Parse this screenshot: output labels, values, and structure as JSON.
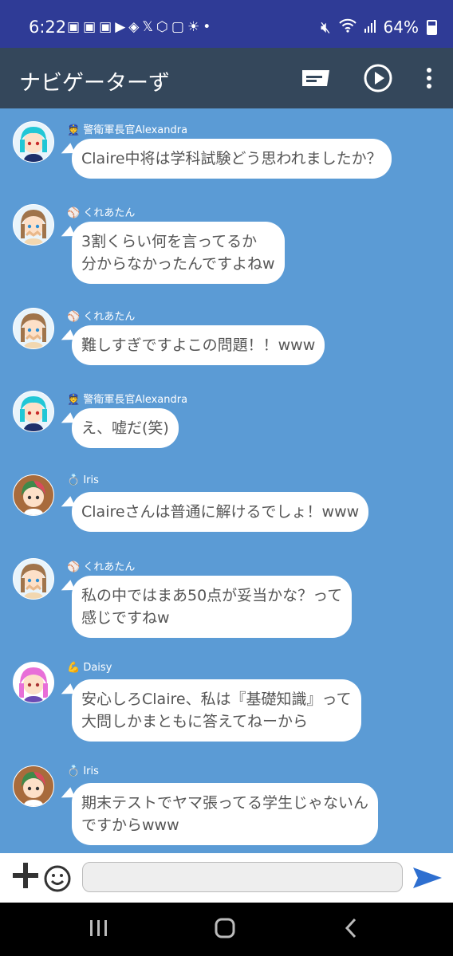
{
  "status_bar": {
    "time": "6:22",
    "notification_icons": [
      "discord-icon",
      "discord-icon",
      "discord-icon",
      "youtube-icon",
      "share-icon",
      "x-icon",
      "cube-icon",
      "lock-icon",
      "sun-icon",
      "dot-icon"
    ],
    "battery": "64%"
  },
  "app_bar": {
    "title": "ナビゲーターず",
    "icons": [
      "subtitle-icon",
      "play-icon",
      "more-vert-icon"
    ]
  },
  "messages": [
    {
      "sender": "警衛軍長官Alexandra",
      "badge": "officer-icon",
      "text": "Claire中将は学科試験どう思われましたか？",
      "avatar": "cyan"
    },
    {
      "sender": "くれあたん",
      "badge": "baseball-icon",
      "text": "3割くらい何を言ってるか\n分からなかったんですよねw",
      "avatar": "brown"
    },
    {
      "sender": "くれあたん",
      "badge": "baseball-icon",
      "text": "難しすぎですよこの問題！！www",
      "avatar": "brown"
    },
    {
      "sender": "警衛軍長官Alexandra",
      "badge": "officer-icon",
      "text": "え、嘘だ(笑)",
      "avatar": "cyan"
    },
    {
      "sender": "Iris",
      "badge": "ring-icon",
      "text": "Claireさんは普通に解けるでしょ！www",
      "avatar": "green"
    },
    {
      "sender": "くれあたん",
      "badge": "baseball-icon",
      "text": "私の中ではまあ50点が妥当かな？って\n感じですねw",
      "avatar": "brown"
    },
    {
      "sender": "Daisy",
      "badge": "muscle-icon",
      "text": "安心しろClaire、私は『基礎知識』って\n大問しかまともに答えてねーから",
      "avatar": "pink"
    },
    {
      "sender": "Iris",
      "badge": "ring-icon",
      "text": "期末テストでヤマ張ってる学生じゃないん\nですからwww",
      "avatar": "green"
    }
  ],
  "input_bar": {
    "placeholder": ""
  },
  "colors": {
    "status_bar": "#2f3b96",
    "app_bar": "#34475b",
    "chat_background": "#5b9bd5",
    "bubble": "#ffffff",
    "send": "#2e6fd0"
  }
}
